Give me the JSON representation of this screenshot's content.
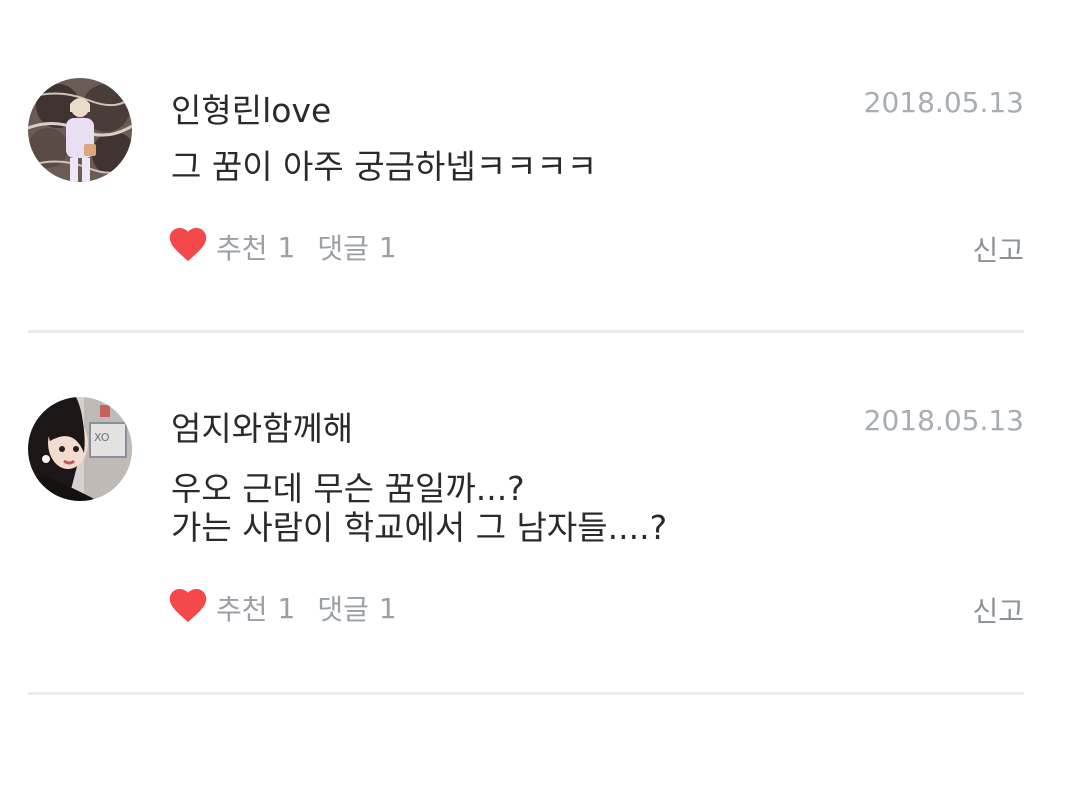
{
  "comments": [
    {
      "username": "인형린love",
      "date": "2018.05.13",
      "lines": [
        "그 꿈이 아주 궁금하넵ㅋㅋㅋㅋ"
      ],
      "like_label": "추천",
      "like_count": "1",
      "reply_label": "댓글",
      "reply_count": "1",
      "report_label": "신고"
    },
    {
      "username": "엄지와함께해",
      "date": "2018.05.13",
      "lines": [
        "우오 근데 무슨 꿈일까...?",
        "가는 사람이 학교에서 그 남자들....?"
      ],
      "like_label": "추천",
      "like_count": "1",
      "reply_label": "댓글",
      "reply_count": "1",
      "report_label": "신고"
    }
  ],
  "colors": {
    "heart": "#f4484a",
    "text_primary": "#2a2a2a",
    "text_muted": "#a8adb3",
    "divider": "#e9ebee"
  },
  "icons": [
    "heart-icon"
  ]
}
